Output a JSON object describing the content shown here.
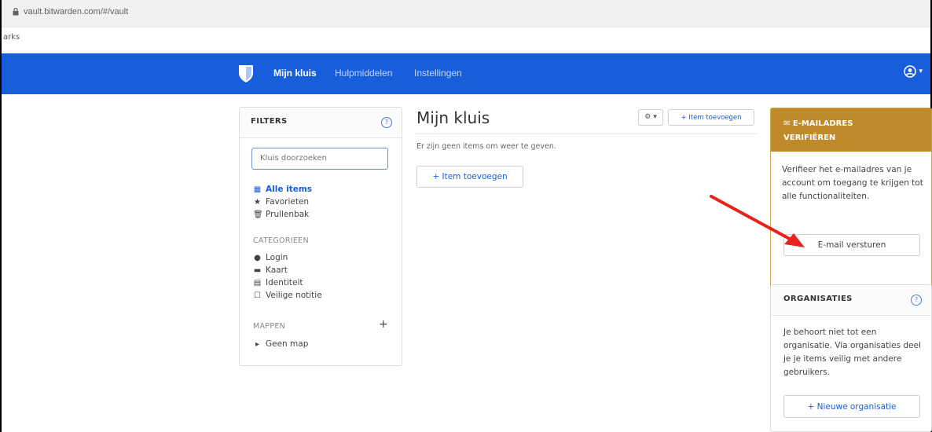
{
  "browser": {
    "url": "vault.bitwarden.com/#/vault",
    "bookmarks_text": "arks"
  },
  "nav": {
    "items": [
      {
        "label": "Mijn kluis",
        "active": true
      },
      {
        "label": "Hulpmiddelen",
        "active": false
      },
      {
        "label": "Instellingen",
        "active": false
      }
    ]
  },
  "filters": {
    "title": "FILTERS",
    "search_placeholder": "Kluis doorzoeken",
    "items": [
      {
        "label": "Alle items",
        "icon": "grid-icon"
      },
      {
        "label": "Favorieten",
        "icon": "star-icon"
      },
      {
        "label": "Prullenbak",
        "icon": "trash-icon"
      }
    ],
    "categories_label": "CATEGORIEEN",
    "categories": [
      {
        "label": "Login",
        "icon": "globe-icon"
      },
      {
        "label": "Kaart",
        "icon": "card-icon"
      },
      {
        "label": "Identiteit",
        "icon": "id-card-icon"
      },
      {
        "label": "Veilige notitie",
        "icon": "note-icon"
      }
    ],
    "folders_label": "MAPPEN",
    "no_folder": "Geen map"
  },
  "main": {
    "title": "Mijn kluis",
    "empty_text": "Er zijn geen items om weer te geven.",
    "add_item_top": "Item toevoegen",
    "add_item": "Item toevoegen"
  },
  "verify": {
    "title_line1": "E-MAILADRES",
    "title_line2": "VERIFIËREN",
    "body": "Verifieer het e-mailadres van je account om toegang te krijgen tot alle functionaliteiten.",
    "button": "E-mail versturen"
  },
  "orgs": {
    "title": "ORGANISATIES",
    "body": "Je behoort niet tot een organisatie. Via organisaties deel je je items veilig met andere gebruikers.",
    "button": "Nieuwe organisatie"
  },
  "colors": {
    "navbar": "#175ddc",
    "warning_header": "#bf8a2a",
    "arrow": "#e8221c"
  }
}
